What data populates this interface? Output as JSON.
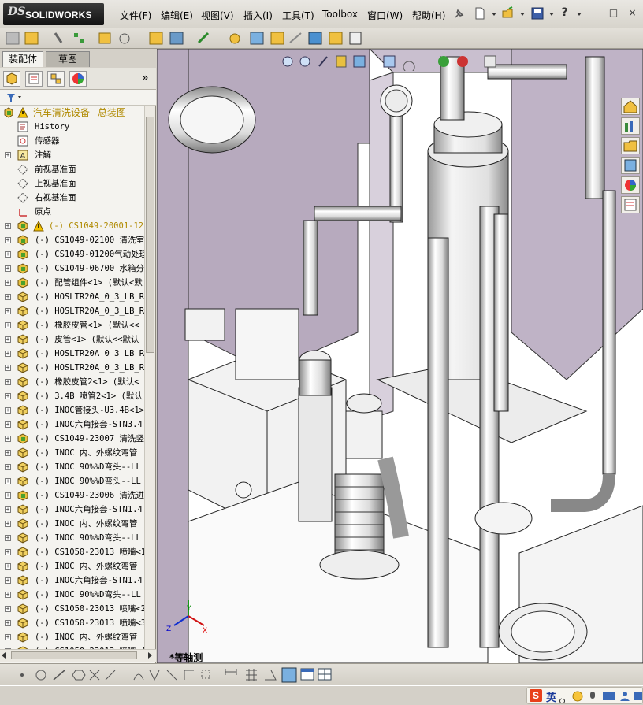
{
  "app": {
    "logo_prefix": "DS",
    "logo_name": "SOLIDWORKS"
  },
  "menu": {
    "items": [
      "文件(F)",
      "编辑(E)",
      "视图(V)",
      "插入(I)",
      "工具(T)",
      "Toolbox",
      "窗口(W)",
      "帮助(H)"
    ],
    "help_symbol": "?",
    "window_controls": [
      "–",
      "□",
      "×"
    ]
  },
  "left_panel": {
    "tabs": [
      "装配体",
      "草图"
    ],
    "expand_symbol": "»",
    "root": {
      "name": "汽车清洗设备",
      "config": "总装图"
    },
    "tree": [
      {
        "label": "History",
        "icon": "history-icon",
        "expand": false
      },
      {
        "label": "传感器",
        "icon": "sensor-icon",
        "expand": false
      },
      {
        "label": "注解",
        "icon": "annotation-icon",
        "expand": true
      },
      {
        "label": "前视基准面",
        "icon": "plane-icon",
        "expand": false
      },
      {
        "label": "上视基准面",
        "icon": "plane-icon",
        "expand": false
      },
      {
        "label": "右视基准面",
        "icon": "plane-icon",
        "expand": false
      },
      {
        "label": "原点",
        "icon": "origin-icon",
        "expand": false
      },
      {
        "label": "(-) CS1049-20001-12",
        "icon": "warning-assembly-icon",
        "expand": true
      },
      {
        "label": "(-) CS1049-02100 清洗室",
        "icon": "assembly-icon",
        "expand": true
      },
      {
        "label": "(-) CS1049-01200气动处理",
        "icon": "assembly-icon",
        "expand": true
      },
      {
        "label": "(-) CS1049-06700 水箱分",
        "icon": "assembly-icon",
        "expand": true
      },
      {
        "label": "(-) 配管组件<1> (默认<默",
        "icon": "assembly-icon",
        "expand": true
      },
      {
        "label": "(-) HOSLTR20A_0_3_LB_RB",
        "icon": "part-icon",
        "expand": true
      },
      {
        "label": "(-) HOSLTR20A_0_3_LB_RB",
        "icon": "part-icon",
        "expand": true
      },
      {
        "label": "(-) 橡胶皮管<1> (默认<<",
        "icon": "part-icon",
        "expand": true
      },
      {
        "label": "(-) 皮管<1> (默认<<默认",
        "icon": "part-icon",
        "expand": true
      },
      {
        "label": "(-) HOSLTR20A_0_3_LB_RB",
        "icon": "part-icon",
        "expand": true
      },
      {
        "label": "(-) HOSLTR20A_0_3_LB_RB",
        "icon": "part-icon",
        "expand": true
      },
      {
        "label": "(-) 橡胶皮管2<1> (默认<",
        "icon": "part-icon",
        "expand": true
      },
      {
        "label": "(-) 3.4B 喷管2<1> (默认",
        "icon": "part-icon",
        "expand": true
      },
      {
        "label": "(-) INOC管接头-U3.4B<1>",
        "icon": "part-icon",
        "expand": true
      },
      {
        "label": "(-) INOC六角接套-STN3.4",
        "icon": "part-icon",
        "expand": true
      },
      {
        "label": "(-) CS1049-23007 清洗竖",
        "icon": "assembly-icon",
        "expand": true
      },
      {
        "label": "(-) INOC 内、外螺纹弯管",
        "icon": "part-icon",
        "expand": true
      },
      {
        "label": "(-) INOC 90%%D弯头--LL",
        "icon": "part-icon",
        "expand": true
      },
      {
        "label": "(-) INOC 90%%D弯头--LL",
        "icon": "part-icon",
        "expand": true
      },
      {
        "label": "(-) CS1049-23006 清洗进",
        "icon": "assembly-icon",
        "expand": true
      },
      {
        "label": "(-) INOC六角接套-STN1.4",
        "icon": "part-icon",
        "expand": true
      },
      {
        "label": "(-) INOC 内、外螺纹弯管",
        "icon": "part-icon",
        "expand": true
      },
      {
        "label": "(-) INOC 90%%D弯头--LL",
        "icon": "part-icon",
        "expand": true
      },
      {
        "label": "(-) CS1050-23013 喷嘴<1",
        "icon": "part-icon",
        "expand": true
      },
      {
        "label": "(-) INOC 内、外螺纹弯管",
        "icon": "part-icon",
        "expand": true
      },
      {
        "label": "(-) INOC六角接套-STN1.4",
        "icon": "part-icon",
        "expand": true
      },
      {
        "label": "(-) INOC 90%%D弯头--LL",
        "icon": "part-icon",
        "expand": true
      },
      {
        "label": "(-) CS1050-23013 喷嘴<2",
        "icon": "part-icon",
        "expand": true
      },
      {
        "label": "(-) CS1050-23013 喷嘴<3",
        "icon": "part-icon",
        "expand": true
      },
      {
        "label": "(-) INOC 内、外螺纹弯管",
        "icon": "part-icon",
        "expand": true
      },
      {
        "label": "(-) CS1050-23013 喷嘴<4",
        "icon": "part-icon",
        "expand": true
      }
    ]
  },
  "viewport": {
    "view_name": "*等轴测",
    "triad": {
      "x": "X",
      "y": "Y",
      "z": "Z"
    }
  },
  "status": {
    "ime_brand": "S",
    "ime_lang": "英"
  },
  "colors": {
    "background_part": "#b3a6bd",
    "warning": "#e6b800",
    "assembly_green": "#4aa02c",
    "part_yellow": "#e8c040"
  }
}
